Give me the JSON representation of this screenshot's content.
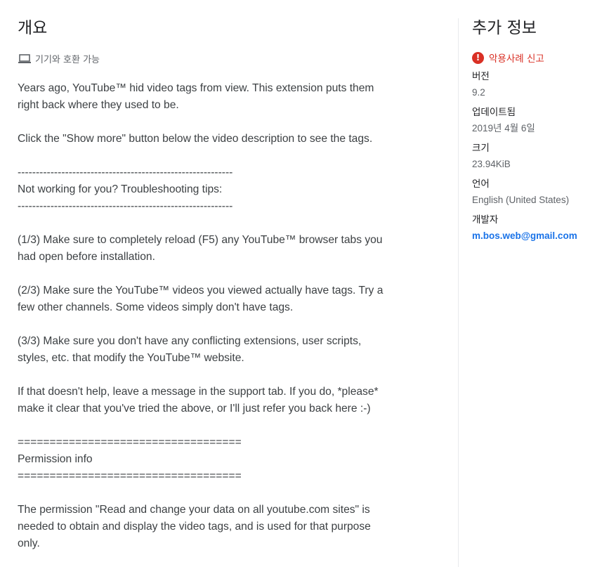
{
  "overview": {
    "title": "개요",
    "compat_icon": "laptop-icon",
    "compat_text": "기기와 호환 가능",
    "description": "Years ago, YouTube™ hid video tags from view. This extension puts them\nright back where they used to be.\n\nClick the \"Show more\" button below the video description to see the tags.\n\n-----------------------------------------------------------\nNot working for you? Troubleshooting tips:\n-----------------------------------------------------------\n\n(1/3) Make sure to completely reload (F5) any YouTube™ browser tabs you\nhad open before installation.\n\n(2/3) Make sure the YouTube™ videos you viewed actually have tags. Try a\nfew other channels. Some videos simply don't have tags.\n\n(3/3) Make sure you don't have any conflicting extensions, user scripts,\nstyles, etc. that modify the YouTube™ website.\n\nIf that doesn't help, leave a message in the support tab. If you do, *please*\nmake it clear that you've tried the above, or I'll just refer you back here :-)\n\n===================================\nPermission info\n===================================\n\nThe permission \"Read and change your data on all youtube.com sites\" is\nneeded to obtain and display the video tags, and is used for that purpose\nonly."
  },
  "additional_info": {
    "title": "추가 정보",
    "report_icon": "alert-icon",
    "report_label": "악용사례 신고",
    "version_label": "버전",
    "version_value": "9.2",
    "updated_label": "업데이트됨",
    "updated_value": "2019년 4월 6일",
    "size_label": "크기",
    "size_value": "23.94KiB",
    "language_label": "언어",
    "language_value": "English (United States)",
    "developer_label": "개발자",
    "developer_email": "m.bos.web@gmail.com"
  },
  "colors": {
    "report_red": "#d93025",
    "link_blue": "#1a73e8"
  }
}
